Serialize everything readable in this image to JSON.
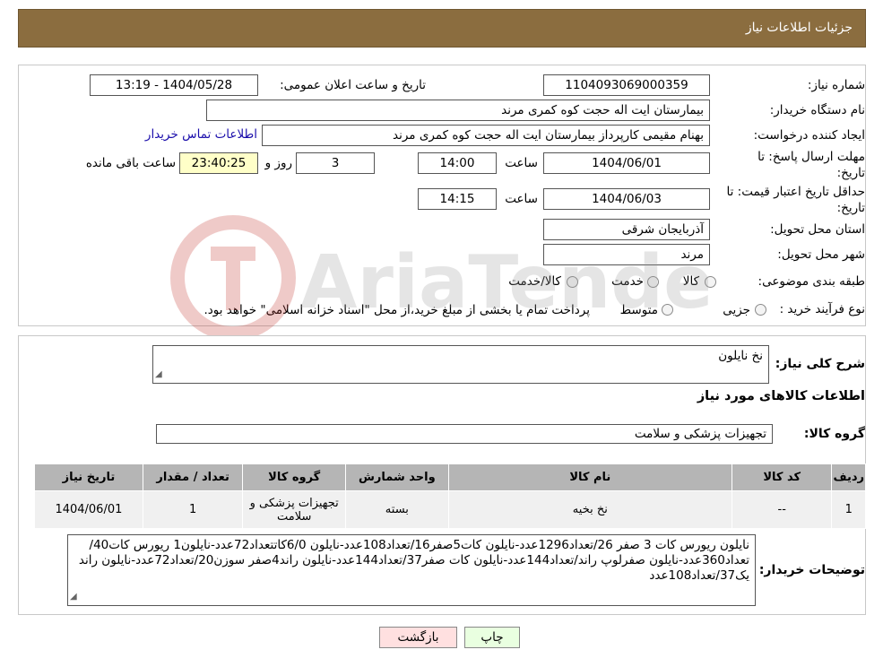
{
  "header": {
    "title": "جزئیات اطلاعات نیاز"
  },
  "form": {
    "need_number_label": "شماره نیاز:",
    "need_number": "1104093069000359",
    "announce_label": "تاریخ و ساعت اعلان عمومی:",
    "announce_value": "1404/05/28 - 13:19",
    "buyer_org_label": "نام دستگاه خریدار:",
    "buyer_org": "بیمارستان ایت اله حجت کوه کمری مرند",
    "creator_label": "ایجاد کننده درخواست:",
    "creator": "بهنام مقیمی کارپرداز بیمارستان ایت اله حجت کوه کمری مرند",
    "contact_link": "اطلاعات تماس خریدار",
    "deadline_label_1": "مهلت ارسال پاسخ: تا",
    "deadline_label_2": "تاریخ:",
    "deadline_date": "1404/06/01",
    "time_label": "ساعت",
    "deadline_time": "14:00",
    "days_value": "3",
    "days_label": "روز و",
    "remaining_time": "23:40:25",
    "remaining_label": "ساعت باقی مانده",
    "validity_label_1": "حداقل تاریخ اعتبار قیمت: تا",
    "validity_label_2": "تاریخ:",
    "validity_date": "1404/06/03",
    "validity_time": "14:15",
    "province_label": "استان محل تحویل:",
    "province": "آذربایجان شرقی",
    "city_label": "شهر محل تحویل:",
    "city": "مرند",
    "category_label": "طبقه بندی موضوعی:",
    "category_options": [
      "کالا",
      "خدمت",
      "کالا/خدمت"
    ],
    "process_label": "نوع فرآیند خرید :",
    "process_options": [
      "جزیی",
      "متوسط"
    ],
    "process_note": "پرداخت تمام یا بخشی از مبلغ خرید،از محل \"اسناد خزانه اسلامی\" خواهد بود."
  },
  "details": {
    "general_desc_label": "شرح کلی نیاز:",
    "general_desc": "نخ نایلون",
    "goods_info_title": "اطلاعات کالاهای مورد نیاز",
    "goods_group_label": "گروه کالا:",
    "goods_group": "تجهیزات پزشکی و سلامت",
    "table": {
      "headers": [
        "ردیف",
        "کد کالا",
        "نام کالا",
        "واحد شمارش",
        "گروه کالا",
        "تعداد / مقدار",
        "تاریخ نیاز"
      ],
      "rows": [
        [
          "1",
          "--",
          "نخ بخیه",
          "بسته",
          "تجهیزات پزشکی و سلامت",
          "1",
          "1404/06/01"
        ]
      ]
    },
    "buyer_notes_label": "توضیحات خریدار:",
    "buyer_notes": "نایلون ریورس کات 3 صفر 26/تعداد1296عدد-نایلون کات5صفر16/تعداد108عدد-نایلون 6/0کاتتعداد72عدد-نایلون1 ریورس کات40/تعداد360عدد-نایلون صفرلوپ راند/تعداد144عدد-نایلون کات صفر37/تعداد144عدد-نایلون راند4صفر سوزن20/تعداد72عدد-نایلون راند یک37/تعداد108عدد"
  },
  "buttons": {
    "print": "چاپ",
    "back": "بازگشت"
  },
  "colors": {
    "header_bg": "#8b6d3f",
    "table_header_bg": "#b5b5b5",
    "back_button_bg": "#ffe0e0",
    "print_button_bg": "#e9ffe0"
  }
}
